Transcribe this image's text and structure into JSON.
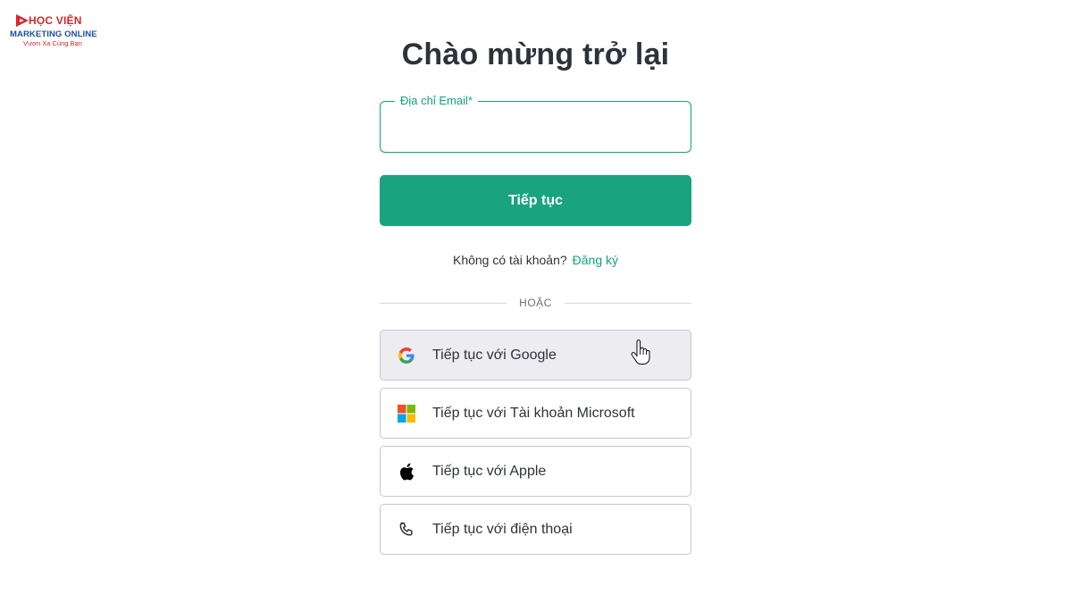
{
  "logo": {
    "line1": "HỌC VIỆN",
    "line2": "MARKETING ONLINE",
    "line3": "Vươn Xa Cùng Bạn"
  },
  "title": "Chào mừng trở lại",
  "email_field": {
    "label": "Địa chỉ Email*",
    "value": "",
    "placeholder": ""
  },
  "continue_button": "Tiếp tục",
  "signup": {
    "prompt": "Không có tài khoản?",
    "link": "Đăng ký"
  },
  "divider_text": "HOẶC",
  "social_buttons": [
    {
      "label": "Tiếp tục với Google",
      "icon": "google-icon"
    },
    {
      "label": "Tiếp tục với Tài khoản Microsoft",
      "icon": "microsoft-icon"
    },
    {
      "label": "Tiếp tục với Apple",
      "icon": "apple-icon"
    },
    {
      "label": "Tiếp tục với điện thoại",
      "icon": "phone-icon"
    }
  ],
  "colors": {
    "accent": "#10a37f",
    "button": "#1aa37f",
    "hover_bg": "#ececf1",
    "logo_red": "#d7262b",
    "logo_blue": "#1c4fa1"
  }
}
